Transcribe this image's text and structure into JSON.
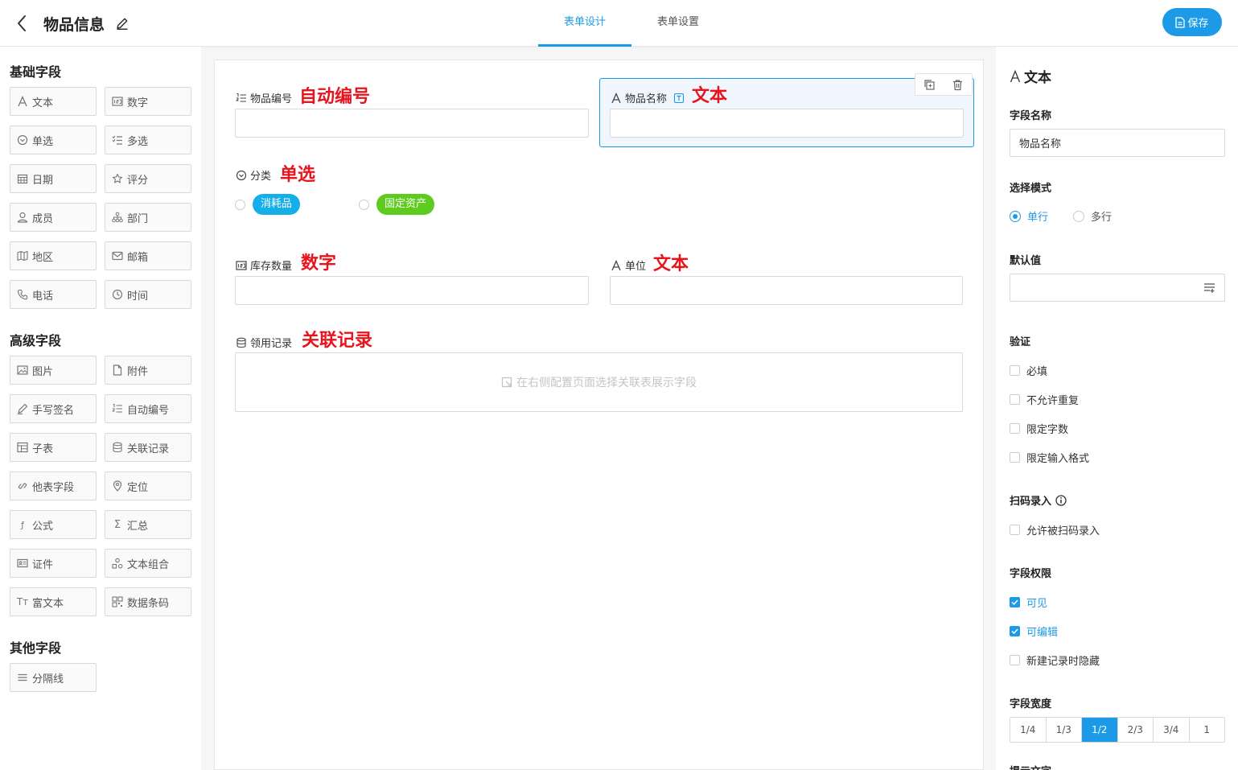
{
  "header": {
    "title": "物品信息",
    "tabs": [
      "表单设计",
      "表单设置"
    ],
    "active_tab": 0,
    "save_label": "保存"
  },
  "colors": {
    "accent": "#1c9ae8",
    "annotation": "#e8141c",
    "pill_consumable": "#16aee8",
    "pill_asset": "#5ecb1f"
  },
  "sidebar": {
    "sections": [
      {
        "title": "基础字段",
        "items": [
          {
            "label": "文本",
            "icon": "text-a-icon"
          },
          {
            "label": "数字",
            "icon": "number-icon"
          },
          {
            "label": "单选",
            "icon": "single-select-icon"
          },
          {
            "label": "多选",
            "icon": "multi-select-icon"
          },
          {
            "label": "日期",
            "icon": "calendar-icon"
          },
          {
            "label": "评分",
            "icon": "star-icon"
          },
          {
            "label": "成员",
            "icon": "user-icon"
          },
          {
            "label": "部门",
            "icon": "org-icon"
          },
          {
            "label": "地区",
            "icon": "map-icon"
          },
          {
            "label": "邮箱",
            "icon": "mail-icon"
          },
          {
            "label": "电话",
            "icon": "phone-icon"
          },
          {
            "label": "时间",
            "icon": "clock-icon"
          }
        ]
      },
      {
        "title": "高级字段",
        "items": [
          {
            "label": "图片",
            "icon": "image-icon"
          },
          {
            "label": "附件",
            "icon": "file-icon"
          },
          {
            "label": "手写签名",
            "icon": "pen-icon"
          },
          {
            "label": "自动编号",
            "icon": "ordered-list-icon"
          },
          {
            "label": "子表",
            "icon": "table-icon"
          },
          {
            "label": "关联记录",
            "icon": "database-icon"
          },
          {
            "label": "他表字段",
            "icon": "link-icon"
          },
          {
            "label": "定位",
            "icon": "location-icon"
          },
          {
            "label": "公式",
            "icon": "formula-icon"
          },
          {
            "label": "汇总",
            "icon": "sigma-icon"
          },
          {
            "label": "证件",
            "icon": "id-card-icon"
          },
          {
            "label": "文本组合",
            "icon": "combine-icon"
          },
          {
            "label": "富文本",
            "icon": "rich-text-icon"
          },
          {
            "label": "数据条码",
            "icon": "qrcode-icon"
          }
        ]
      },
      {
        "title": "其他字段",
        "items": [
          {
            "label": "分隔线",
            "icon": "divider-icon"
          }
        ]
      }
    ]
  },
  "form": {
    "fields": [
      {
        "label": "物品编号",
        "annotation": "自动编号",
        "icon": "ordered-list-icon"
      },
      {
        "label": "物品名称",
        "annotation": "文本",
        "icon": "text-a-icon"
      },
      {
        "label": "分类",
        "annotation": "单选",
        "icon": "single-select-icon",
        "options": [
          "消耗品",
          "固定资产"
        ]
      },
      {
        "label": "库存数量",
        "annotation": "数字",
        "icon": "number-icon"
      },
      {
        "label": "单位",
        "annotation": "文本",
        "icon": "text-a-icon"
      },
      {
        "label": "领用记录",
        "annotation": "关联记录",
        "icon": "database-icon",
        "placeholder": "在右侧配置页面选择关联表展示字段"
      }
    ]
  },
  "props": {
    "type_title": "文本",
    "field_name_label": "字段名称",
    "field_name_value": "物品名称",
    "mode_label": "选择模式",
    "mode_options": [
      "单行",
      "多行"
    ],
    "mode_selected": 0,
    "default_label": "默认值",
    "validation_label": "验证",
    "validation_options": [
      {
        "label": "必填",
        "checked": false
      },
      {
        "label": "不允许重复",
        "checked": false
      },
      {
        "label": "限定字数",
        "checked": false
      },
      {
        "label": "限定输入格式",
        "checked": false
      }
    ],
    "scan_label": "扫码录入",
    "scan_options": [
      {
        "label": "允许被扫码录入",
        "checked": false
      }
    ],
    "perm_label": "字段权限",
    "perm_options": [
      {
        "label": "可见",
        "checked": true
      },
      {
        "label": "可编辑",
        "checked": true
      },
      {
        "label": "新建记录时隐藏",
        "checked": false
      }
    ],
    "width_label": "字段宽度",
    "width_options": [
      "1/4",
      "1/3",
      "1/2",
      "2/3",
      "3/4",
      "1"
    ],
    "width_selected": 2,
    "hint_label": "提示文字"
  }
}
